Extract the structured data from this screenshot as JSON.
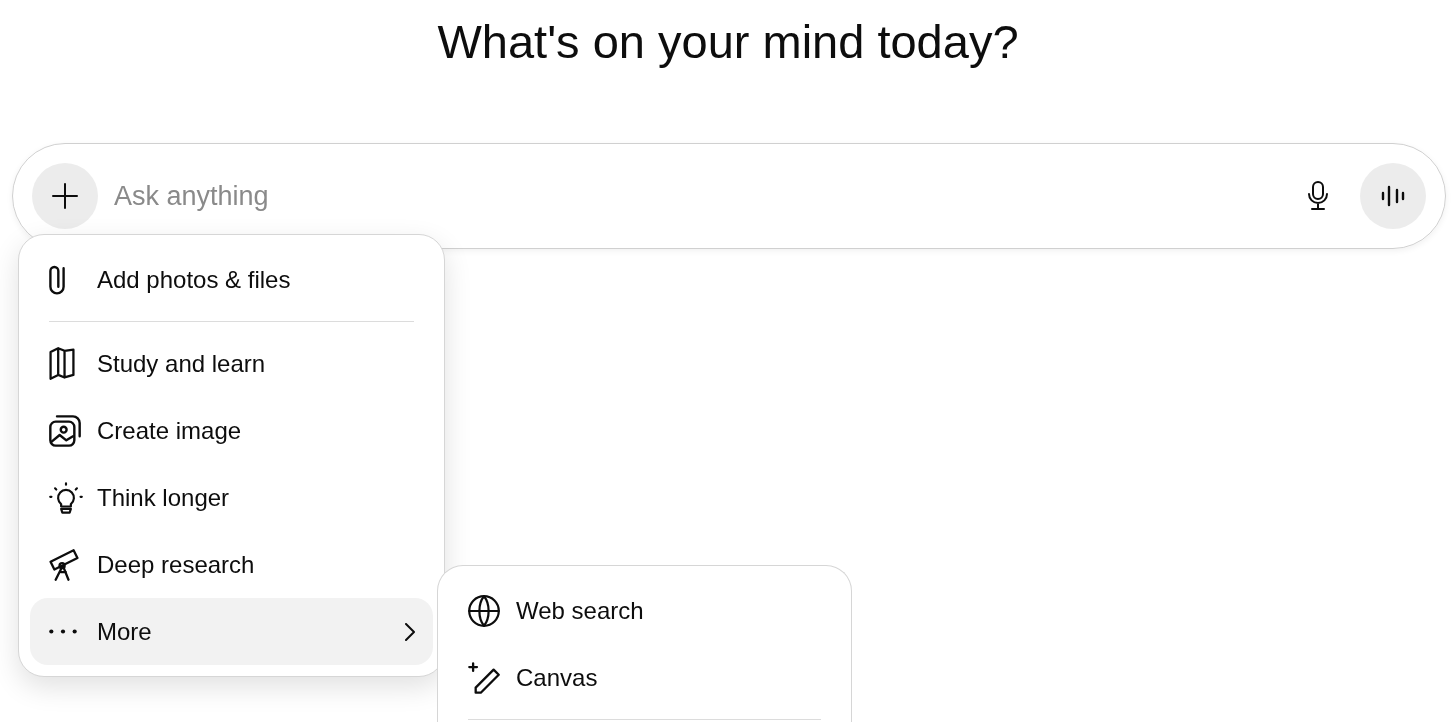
{
  "heading": "What's on your mind today?",
  "composer": {
    "placeholder": "Ask anything"
  },
  "menu": {
    "items": [
      {
        "kind": "item",
        "label": "Add photos & files",
        "selected": false
      },
      {
        "kind": "divider"
      },
      {
        "kind": "item",
        "label": "Study and learn",
        "selected": false
      },
      {
        "kind": "item",
        "label": "Create image",
        "selected": false
      },
      {
        "kind": "item",
        "label": "Think longer",
        "selected": false
      },
      {
        "kind": "item",
        "label": "Deep research",
        "selected": false
      },
      {
        "kind": "submenu",
        "label": "More",
        "selected": true
      }
    ]
  },
  "submenu": {
    "items": [
      {
        "kind": "item",
        "label": "Web search",
        "selected": false
      },
      {
        "kind": "item",
        "label": "Canvas",
        "selected": false
      },
      {
        "kind": "divider"
      }
    ]
  }
}
